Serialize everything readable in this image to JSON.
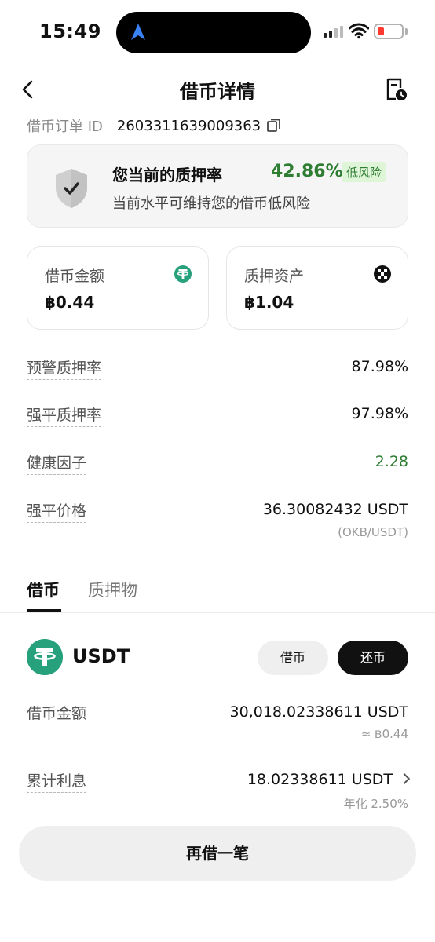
{
  "status_bar": {
    "time": "15:49"
  },
  "nav": {
    "title": "借币详情"
  },
  "order": {
    "label": "借币订单 ID",
    "id": "2603311639009363"
  },
  "risk": {
    "title": "您当前的质押率",
    "percent": "42.86%",
    "badge": "低风险",
    "subtitle": "当前水平可维持您的借币低风险",
    "color": "#2e7d32"
  },
  "borrow_amount_card": {
    "label": "借币金额",
    "value": "฿0.44",
    "icon": "tether-icon"
  },
  "collateral_card": {
    "label": "质押资产",
    "value": "฿1.04",
    "icon": "okb-icon"
  },
  "info_rows": {
    "warning_ratio": {
      "label": "预警质押率",
      "value": "87.98%"
    },
    "liquidation_ratio": {
      "label": "强平质押率",
      "value": "97.98%"
    },
    "health_factor": {
      "label": "健康因子",
      "value": "2.28"
    },
    "liquidation_price": {
      "label": "强平价格",
      "value": "36.30082432 USDT",
      "sub": "(OKB/USDT)"
    }
  },
  "tabs": [
    {
      "label": "借币",
      "active": true
    },
    {
      "label": "质押物",
      "active": false
    }
  ],
  "asset": {
    "name": "USDT",
    "borrow_button": "借币",
    "repay_button": "还币",
    "borrowed": {
      "label": "借币金额",
      "value": "30,018.02338611 USDT",
      "sub": "≈ ฿0.44"
    },
    "interest": {
      "label": "累计利息",
      "value": "18.02338611 USDT",
      "sub": "年化 2.50%"
    }
  },
  "bottom_button": "再借一笔"
}
